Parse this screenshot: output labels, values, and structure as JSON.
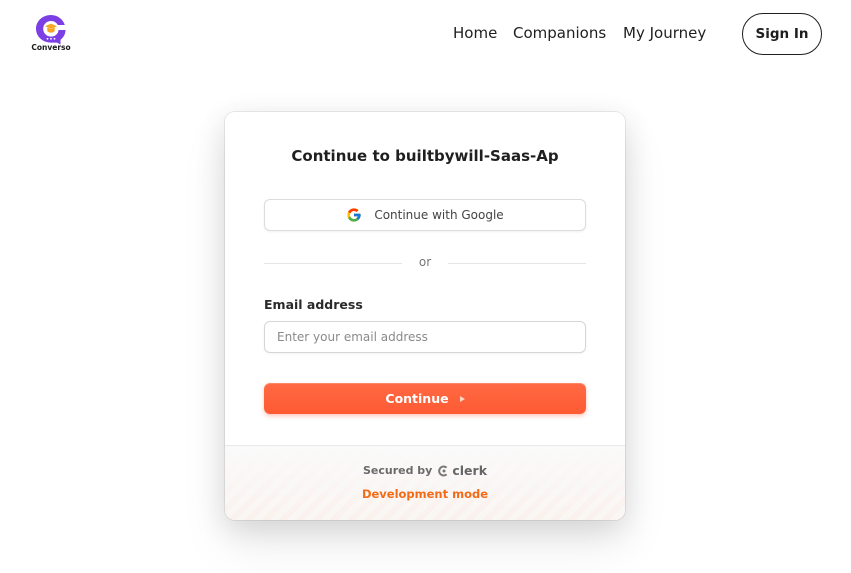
{
  "navbar": {
    "logo": {
      "name": "Converso",
      "icon": "graduation-cap-chat-icon",
      "colors": {
        "bubble": "#7b3fe4",
        "cap": "#f5a623"
      }
    },
    "links": [
      {
        "label": "Home"
      },
      {
        "label": "Companions"
      },
      {
        "label": "My Journey"
      }
    ],
    "sign_in_label": "Sign In"
  },
  "auth_card": {
    "title": "Continue to builtbywill-Saas-Ap",
    "google_button_label": "Continue with Google",
    "divider_text": "or",
    "email": {
      "label": "Email address",
      "placeholder": "Enter your email address",
      "value": ""
    },
    "continue_label": "Continue",
    "footer": {
      "secured_by": "Secured by",
      "provider": "clerk",
      "mode": "Development mode"
    }
  },
  "colors": {
    "accent": "#fe5a33",
    "dev_mode": "#f36b16",
    "text": "#1f1f1f"
  }
}
